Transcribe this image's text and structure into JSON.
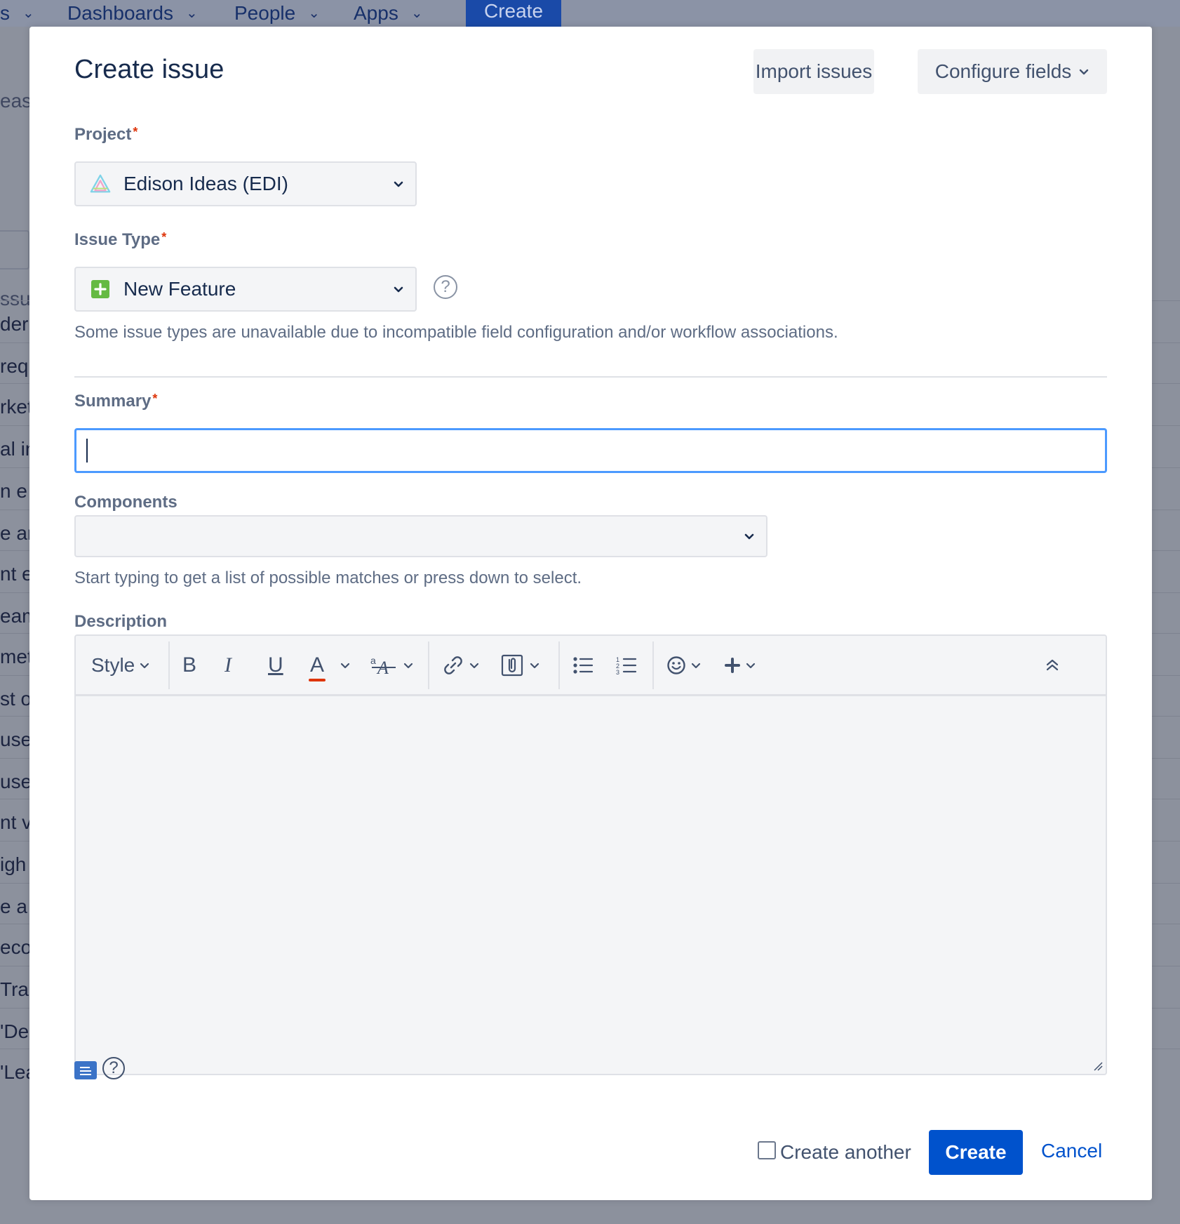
{
  "topnav": {
    "items": [
      {
        "label": "s"
      },
      {
        "label": "Dashboards"
      },
      {
        "label": "People"
      },
      {
        "label": "Apps"
      }
    ],
    "create_label": "Create"
  },
  "background": {
    "side_labels": [
      "eas",
      "ssu"
    ],
    "rows": [
      "der",
      "requ",
      "rket",
      "al in",
      "n e",
      "e ar",
      "nt e",
      "eam",
      "meta",
      "st o",
      "user",
      "user",
      "nt v",
      "igh",
      "e a",
      "eco",
      " Tra",
      "'De",
      "'Lead time for changes' metric"
    ]
  },
  "modal": {
    "title": "Create issue",
    "import_label": "Import issues",
    "configure_label": "Configure fields",
    "project": {
      "label": "Project",
      "required_mark": "*",
      "value": "Edison Ideas (EDI)"
    },
    "issue_type": {
      "label": "Issue Type",
      "required_mark": "*",
      "value": "New Feature",
      "help": "?",
      "note": "Some issue types are unavailable due to incompatible field configuration and/or workflow associations."
    },
    "summary": {
      "label": "Summary",
      "required_mark": "*",
      "value": ""
    },
    "components": {
      "label": "Components",
      "value": "",
      "hint": "Start typing to get a list of possible matches or press down to select."
    },
    "description": {
      "label": "Description",
      "toolbar": {
        "style_label": "Style",
        "bold": "B",
        "italic": "I",
        "underline": "U",
        "text_color": "A"
      },
      "help": "?"
    },
    "footer": {
      "create_another_label": "Create another",
      "create_another_checked": false,
      "create_label": "Create",
      "cancel_label": "Cancel"
    }
  },
  "colors": {
    "primary": "#0052cc",
    "focus_border": "#4c9aff",
    "required": "#de350b",
    "new_feature_icon": "#65ba43",
    "underline_color": "#de350b"
  },
  "icons": [
    "project-avatar-icon",
    "new-feature-icon",
    "chevron-down-icon",
    "help-icon",
    "link-icon",
    "attachment-icon",
    "bullet-list-icon",
    "numbered-list-icon",
    "emoji-icon",
    "plus-icon",
    "collapse-icon",
    "wiki-markup-icon"
  ]
}
